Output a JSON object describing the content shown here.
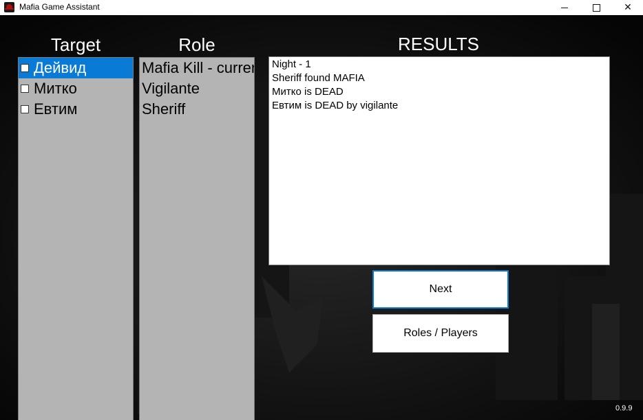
{
  "window": {
    "title": "Mafia Game Assistant",
    "minimize_glyph": "—",
    "maximize_glyph": "□",
    "close_glyph": "✕"
  },
  "columns": {
    "target_header": "Target",
    "role_header": "Role",
    "results_header": "RESULTS"
  },
  "targets": [
    {
      "label": "Дейвид",
      "selected": true,
      "checked": false
    },
    {
      "label": "Митко",
      "selected": false,
      "checked": false
    },
    {
      "label": "Евтим",
      "selected": false,
      "checked": false
    }
  ],
  "roles": [
    {
      "label": "Mafia Kill - current"
    },
    {
      "label": "Vigilante"
    },
    {
      "label": "Sheriff"
    }
  ],
  "results": {
    "lines": [
      "Night - 1",
      "Sheriff found MAFIA",
      "Митко is DEAD",
      "Евтим is DEAD by vigilante"
    ]
  },
  "buttons": {
    "next_label": "Next",
    "roles_players_label": "Roles / Players"
  },
  "version": "0.9.9",
  "colors": {
    "selection": "#0a7ad7",
    "list_background": "#b4b4b4",
    "window_background": "#050505"
  }
}
